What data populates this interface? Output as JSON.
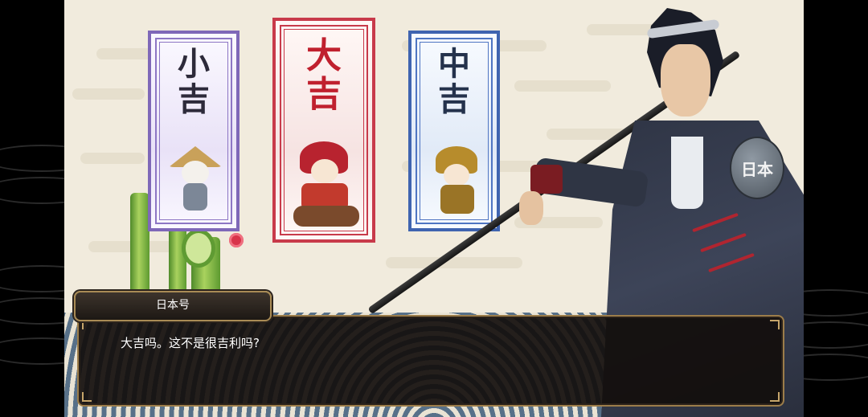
{
  "fortunes": [
    {
      "glyph1": "小",
      "glyph2": "吉",
      "theme": "#7f68b8"
    },
    {
      "glyph1": "大",
      "glyph2": "吉",
      "theme": "#c83a4a"
    },
    {
      "glyph1": "中",
      "glyph2": "吉",
      "theme": "#3f64b0"
    }
  ],
  "dialog": {
    "speaker": "日本号",
    "line": "大吉吗。这不是很吉利吗?"
  },
  "gourd_label": "日本",
  "colors": {
    "accent_red": "#c0202e",
    "dialog_bg": "#120e0c",
    "border_gold": "#9c7d4a"
  }
}
